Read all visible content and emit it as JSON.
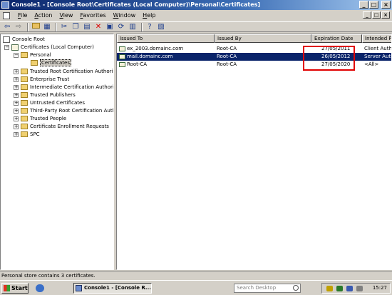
{
  "window": {
    "title": "Console1 - [Console Root\\Certificates (Local Computer)\\Personal\\Certificates]",
    "controls": {
      "minimize": "_",
      "maximize": "□",
      "close": "×"
    },
    "mdi_controls": {
      "minimize": "_",
      "restore": "□",
      "close": "×"
    }
  },
  "menu": {
    "items": [
      "File",
      "Action",
      "View",
      "Favorites",
      "Window",
      "Help"
    ]
  },
  "toolbar": {
    "buttons": [
      "back-arrow-icon",
      "forward-arrow-icon",
      "up-folder-icon",
      "show-hide-tree-icon",
      "cut-icon",
      "copy-icon",
      "paste-icon",
      "delete-icon",
      "properties-icon",
      "refresh-icon",
      "export-list-icon",
      "help-icon",
      "console-tree-icon"
    ]
  },
  "tree": {
    "items": [
      {
        "label": "Console Root",
        "level": 0,
        "icon": "console-root-icon"
      },
      {
        "label": "Certificates (Local Computer)",
        "level": 1,
        "icon": "certificate-store-icon",
        "expanded": true
      },
      {
        "label": "Personal",
        "level": 2,
        "icon": "folder-open-icon",
        "expanded": true
      },
      {
        "label": "Certificates",
        "level": 3,
        "icon": "folder-open-icon",
        "selected": true
      },
      {
        "label": "Trusted Root Certification Authorit",
        "level": 2,
        "icon": "folder-icon"
      },
      {
        "label": "Enterprise Trust",
        "level": 2,
        "icon": "folder-icon"
      },
      {
        "label": "Intermediate Certification Authorit",
        "level": 2,
        "icon": "folder-icon"
      },
      {
        "label": "Trusted Publishers",
        "level": 2,
        "icon": "folder-icon"
      },
      {
        "label": "Untrusted Certificates",
        "level": 2,
        "icon": "folder-icon"
      },
      {
        "label": "Third-Party Root Certification Auth",
        "level": 2,
        "icon": "folder-icon"
      },
      {
        "label": "Trusted People",
        "level": 2,
        "icon": "folder-icon"
      },
      {
        "label": "Certificate Enrollment Requests",
        "level": 2,
        "icon": "folder-icon"
      },
      {
        "label": "SPC",
        "level": 2,
        "icon": "folder-icon"
      }
    ]
  },
  "list": {
    "columns": [
      "Issued To",
      "Issued By",
      "Expiration Date",
      "Intended Pu"
    ],
    "rows": [
      {
        "issued_to": "ex_2003.domainc.com",
        "issued_by": "Root-CA",
        "expiration": "27/05/2011",
        "purpose": "Client Authe",
        "selected": false
      },
      {
        "issued_to": "mail.domainc.com",
        "issued_by": "Root-CA",
        "expiration": "26/05/2012",
        "purpose": "Server Auth",
        "selected": true
      },
      {
        "issued_to": "Root-CA",
        "issued_by": "Root-CA",
        "expiration": "27/05/2020",
        "purpose": "<All>",
        "selected": false
      }
    ],
    "highlight_color": "#e00000"
  },
  "status": {
    "text": "Personal store contains 3 certificates."
  },
  "taskbar": {
    "start_label": "Start",
    "task_label": "Console1 - [Console R...",
    "search_placeholder": "Search Desktop",
    "clock": "15:27"
  },
  "colors": {
    "title_bar": "#0a246a",
    "selection": "#0a246a",
    "chrome": "#d4d0c8"
  }
}
